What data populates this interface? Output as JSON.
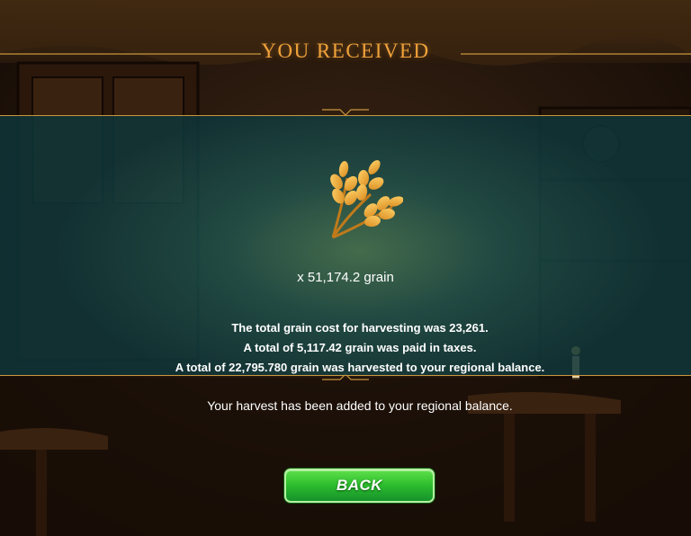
{
  "dialog": {
    "title": "YOU RECEIVED",
    "reward_icon": "wheat-icon",
    "reward_amount": "x 51,174.2 grain",
    "messages": [
      "The total grain cost for harvesting was 23,261.",
      "A total of 5,117.42 grain was paid in taxes.",
      "A total of 22,795.780 grain was harvested to your regional balance."
    ],
    "note": "Your harvest has been added to your regional balance.",
    "back_label": "BACK"
  },
  "colors": {
    "title": "#f0a23a",
    "gold_line": "#c9963e",
    "panel": "#1e5550",
    "button": "#2fbf2f"
  }
}
